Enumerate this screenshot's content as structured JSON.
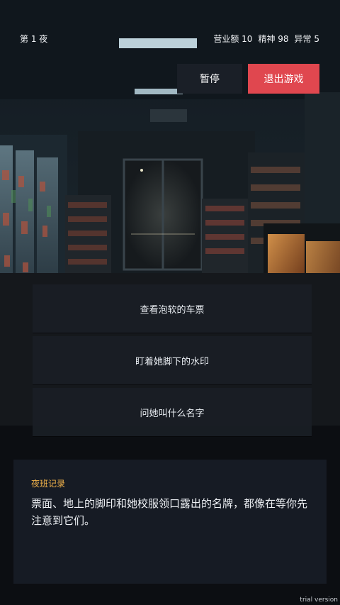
{
  "hud": {
    "night": "第 1 夜",
    "stats": [
      "营业额 10",
      "精神 98",
      "异常 5"
    ]
  },
  "buttons": {
    "pause": "暂停",
    "exit": "退出游戏"
  },
  "choices": [
    "查看泡软的车票",
    "盯着她脚下的水印",
    "问她叫什么名字"
  ],
  "log": {
    "title": "夜班记录",
    "text": "票面、地上的脚印和她校服领口露出的名牌，都像在等你先注意到它们。"
  },
  "watermark": "trial version",
  "colors": {
    "accent_red": "#e0474f",
    "log_title": "#f1b24a",
    "panel": "#161b24"
  }
}
